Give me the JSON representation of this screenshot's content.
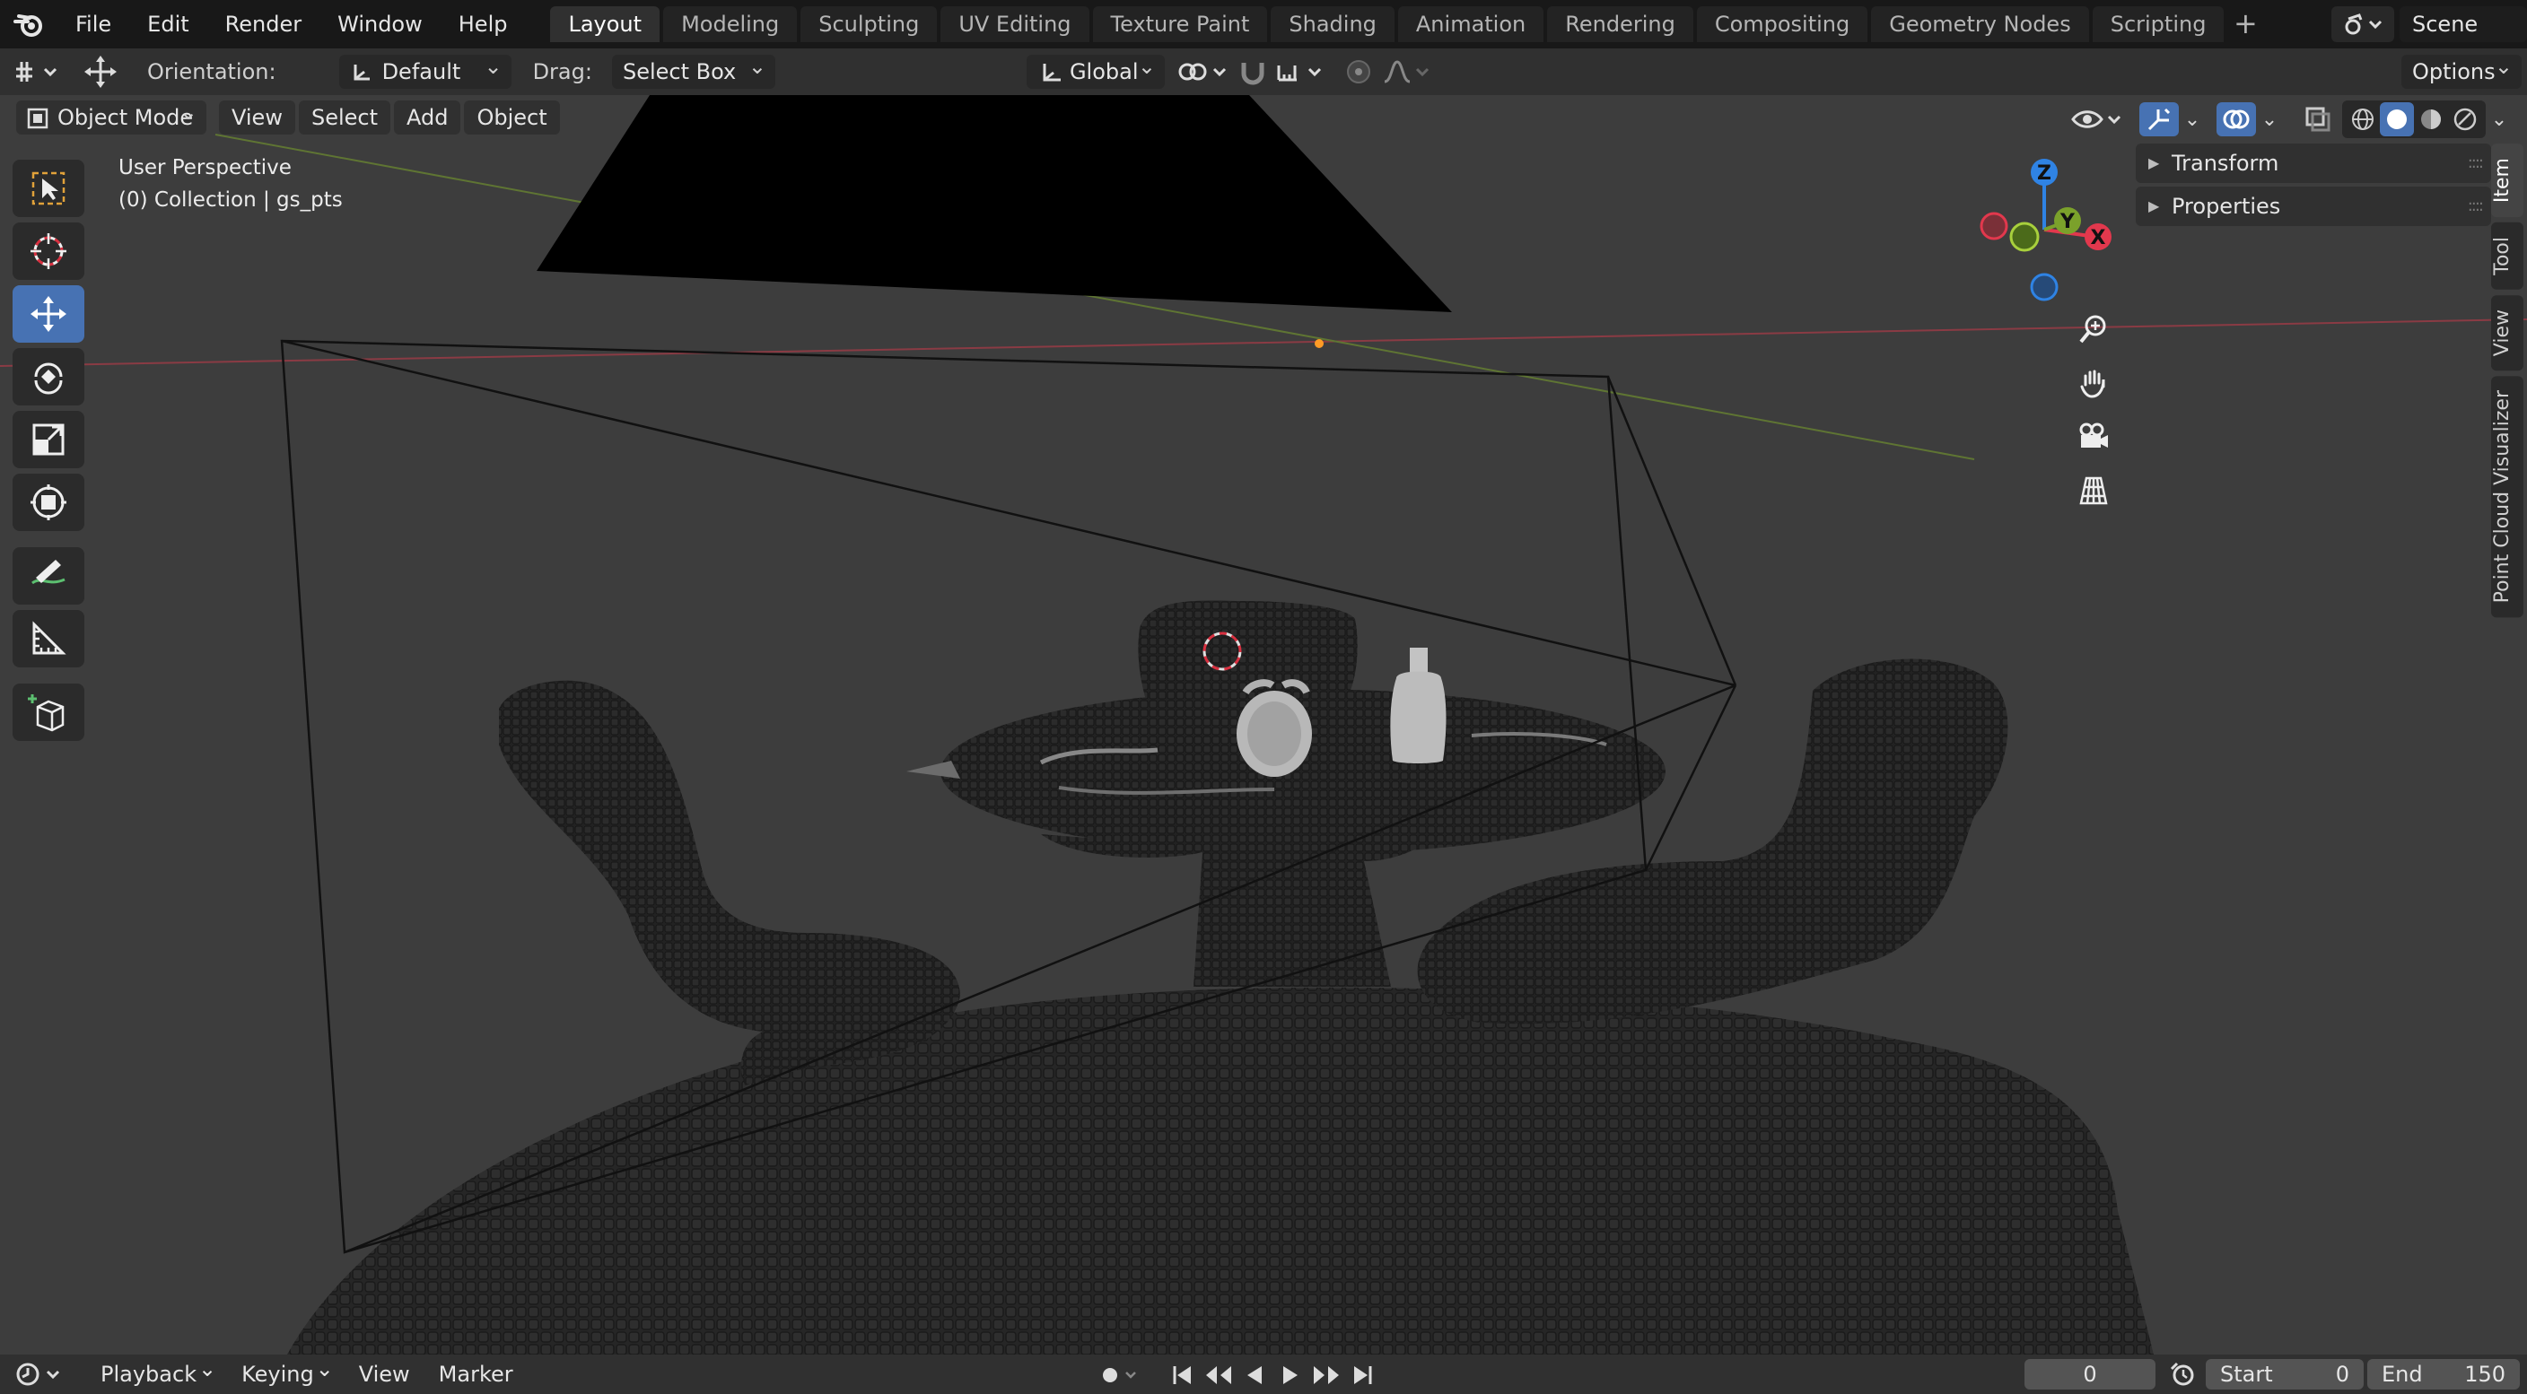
{
  "menubar": {
    "items": [
      "File",
      "Edit",
      "Render",
      "Window",
      "Help"
    ]
  },
  "workspaces": {
    "tabs": [
      "Layout",
      "Modeling",
      "Sculpting",
      "UV Editing",
      "Texture Paint",
      "Shading",
      "Animation",
      "Rendering",
      "Compositing",
      "Geometry Nodes",
      "Scripting"
    ],
    "active": "Layout",
    "add_label": "+"
  },
  "scene": {
    "name": "Scene"
  },
  "tool_header": {
    "orientation_label": "Orientation:",
    "orientation_value": "Default",
    "drag_label": "Drag:",
    "drag_value": "Select Box",
    "transform_orientation": "Global",
    "options_label": "Options"
  },
  "viewport_header": {
    "mode": "Object Mode",
    "menus": [
      "View",
      "Select",
      "Add",
      "Object"
    ]
  },
  "viewport": {
    "perspective_label": "User Perspective",
    "collection_label": "(0) Collection | gs_pts",
    "gizmo_axes": {
      "z": "Z",
      "y": "Y",
      "x": "X"
    }
  },
  "toolbar": {
    "tools": [
      "select-box",
      "cursor",
      "move",
      "rotate",
      "scale",
      "transform",
      "annotate",
      "measure",
      "add-cube"
    ],
    "active": "move"
  },
  "npanel": {
    "sections": [
      "Transform",
      "Properties"
    ],
    "tabs": [
      "Item",
      "Tool",
      "View",
      "Point Cloud Visualizer"
    ],
    "active_tab": "Item"
  },
  "timeline": {
    "menus": [
      "Playback",
      "Keying",
      "View",
      "Marker"
    ],
    "current_frame": "0",
    "start_label": "Start",
    "start_value": "0",
    "end_label": "End",
    "end_value": "150"
  },
  "colors": {
    "accent": "#4772b3",
    "axis_x": "#e2384d",
    "axis_y": "#7ba12b",
    "axis_z": "#2f83e4",
    "viewport_bg": "#3d3d3d"
  }
}
